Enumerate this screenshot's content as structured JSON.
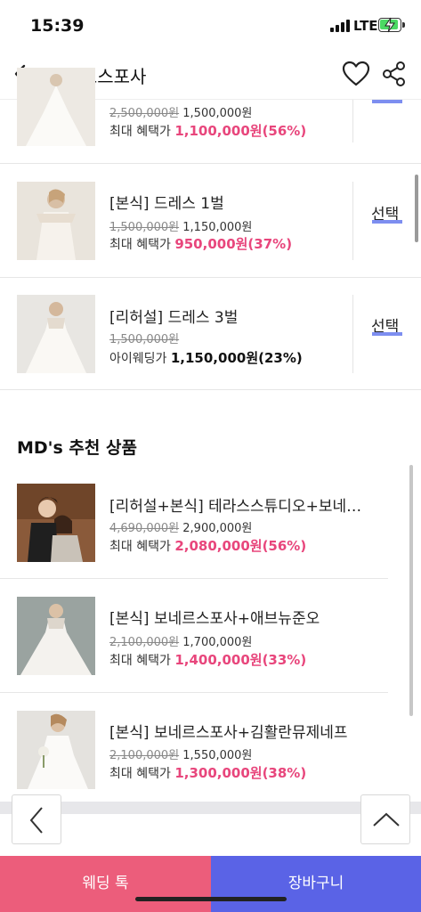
{
  "status": {
    "time": "15:39",
    "network": "LTE"
  },
  "header": {
    "title": "보네르스포사"
  },
  "products": [
    {
      "title": "",
      "original_price": "2,500,000원",
      "price": "1,500,000원",
      "benefit_label": "최대 혜택가",
      "benefit_value": "1,100,000원(56%)",
      "benefit_style": "pink",
      "action": "선택"
    },
    {
      "title": "[본식] 드레스 1벌",
      "original_price": "1,500,000원",
      "price": "1,150,000원",
      "benefit_label": "최대 혜택가",
      "benefit_value": "950,000원(37%)",
      "benefit_style": "pink",
      "action": "선택"
    },
    {
      "title": "[리허설] 드레스 3벌",
      "original_price": "1,500,000원",
      "price": "",
      "benefit_label": "아이웨딩가",
      "benefit_value": "1,150,000원(23%)",
      "benefit_style": "bold",
      "action": "선택"
    }
  ],
  "md_section": {
    "title": "MD's 추천 상품",
    "items": [
      {
        "title": "[리허설+본식] 테라스스튜디오+보네…",
        "original_price": "4,690,000원",
        "price": "2,900,000원",
        "benefit_label": "최대 혜택가",
        "benefit_value": "2,080,000원(56%)"
      },
      {
        "title": "[본식] 보네르스포사+애브뉴준오",
        "original_price": "2,100,000원",
        "price": "1,700,000원",
        "benefit_label": "최대 혜택가",
        "benefit_value": "1,400,000원(33%)"
      },
      {
        "title": "[본식] 보네르스포사+김활란뮤제네프",
        "original_price": "2,100,000원",
        "price": "1,550,000원",
        "benefit_label": "최대 혜택가",
        "benefit_value": "1,300,000원(38%)"
      }
    ]
  },
  "bottom": {
    "talk_label": "웨딩 톡",
    "cart_label": "장바구니"
  },
  "colors": {
    "accent_pink": "#e8467c",
    "talk_bg": "#ec5d7b",
    "cart_bg": "#5a63e6",
    "select_underline": "#7d8ef0"
  },
  "icons": [
    "back-arrow-icon",
    "heart-icon",
    "share-icon",
    "chevron-left-icon",
    "chevron-up-icon",
    "signal-icon",
    "battery-icon"
  ]
}
